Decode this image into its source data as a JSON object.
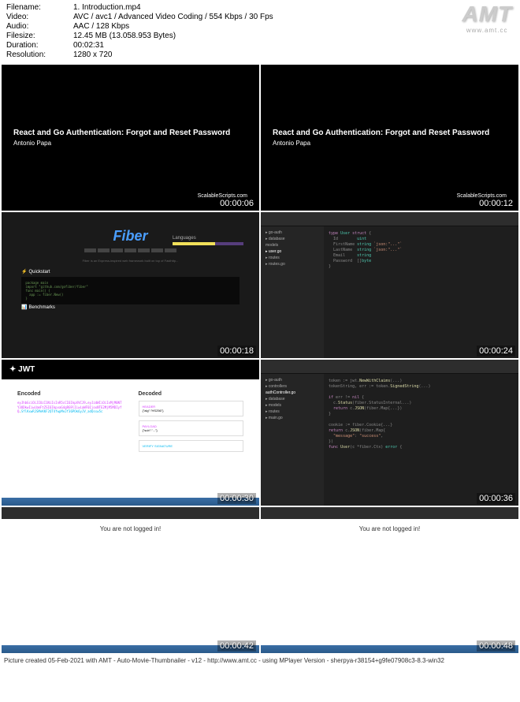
{
  "meta": {
    "filename_label": "Filename:",
    "filename": "1. Introduction.mp4",
    "video_label": "Video:",
    "video": "AVC / avc1 / Advanced Video Coding / 554 Kbps / 30 Fps",
    "audio_label": "Audio:",
    "audio": "AAC / 128 Kbps",
    "filesize_label": "Filesize:",
    "filesize": "12.45 MB (13.058.953 Bytes)",
    "duration_label": "Duration:",
    "duration": "00:02:31",
    "resolution_label": "Resolution:",
    "resolution": "1280 x 720"
  },
  "logo": {
    "text": "AMT",
    "url": "www.amt.cc"
  },
  "thumbs": {
    "t1": {
      "ts": "00:00:06",
      "title": "React and Go Authentication: Forgot and Reset Password",
      "author": "Antonio Papa",
      "brand": "ScalableScripts.com"
    },
    "t2": {
      "ts": "00:00:12",
      "title": "React and Go Authentication: Forgot and Reset Password",
      "author": "Antonio Papa",
      "brand": "ScalableScripts.com"
    },
    "t3": {
      "ts": "00:00:18",
      "fiber": "Fiber",
      "quickstart": "⚡ Quickstart",
      "benchmarks": "📊 Benchmarks",
      "languages": "Languages"
    },
    "t4": {
      "ts": "00:00:24",
      "sidebar": [
        "▸ go-auth",
        "▸ database",
        "  models",
        "  ▸ user.go",
        "▸ routes",
        "▸ routes.go"
      ],
      "code": [
        "type User struct {",
        "  Id        uint",
        "  FirstName string",
        "  LastName  string",
        "  Email     string",
        "  Password  []byte",
        "}"
      ]
    },
    "t5": {
      "ts": "00:00:30",
      "jwt_logo": "✦ JWT",
      "encoded": "Encoded",
      "decoded": "Decoded",
      "token": "eyJhbGciOiJIUzI1NiIsInR5cCI6IkpXVCJ9.eyJzdWIiOiIxMjM0NTY3ODkwIiwibmFtZSI6IkpvaG4gRG9lIiwiaWF0IjoxNTE2MjM5MDIyfQ.SflKxwRJSMeKKF2QT4fwpMeJf36POk6yJV_adQssw5c",
      "header_lbl": "HEADER",
      "payload_lbl": "PAYLOAD",
      "sig_lbl": "VERIFY SIGNATURE"
    },
    "t6": {
      "ts": "00:00:36",
      "sidebar": [
        "▸ go-auth",
        "▸ controllers",
        "  authController.go",
        "▸ database",
        "▸ models",
        "▸ routes",
        "▸ main.go"
      ],
      "code": [
        "token := jwt.NewWithClaims(...)",
        "tokenString, err := token.SignedString(...)",
        "",
        "if err != nil {",
        "  c.Status(fiber.StatusInternalServerError)",
        "  return c.JSON(fiber.Map{...})",
        "}",
        "",
        "cookie := fiber.Cookie{...}"
      ]
    },
    "t7": {
      "ts": "00:00:42",
      "msg": "You are not logged in!"
    },
    "t8": {
      "ts": "00:00:48",
      "msg": "You are not logged in!"
    }
  },
  "footer": "Picture created 05-Feb-2021 with AMT - Auto-Movie-Thumbnailer - v12 - http://www.amt.cc - using MPlayer Version - sherpya-r38154+g9fe07908c3-8.3-win32"
}
